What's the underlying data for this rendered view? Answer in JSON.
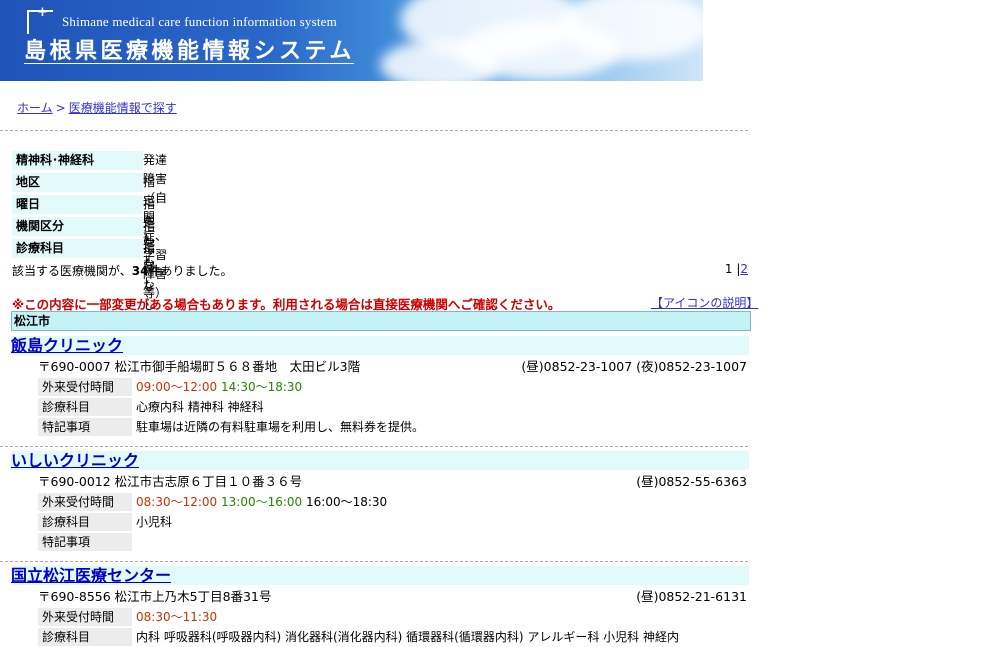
{
  "banner": {
    "subtitle": "Shimane medical care function information system",
    "title": "島根県医療機能情報システム"
  },
  "breadcrumb": {
    "home": "ホーム",
    "separator": ">",
    "current": "医療機能情報で探す"
  },
  "criteria": [
    {
      "label": "精神科･神経科",
      "value": "発達障害（自閉症、学習障害等）"
    },
    {
      "label": "地区",
      "value": "指定なし"
    },
    {
      "label": "曜日",
      "value": "指定なし"
    },
    {
      "label": "機関区分",
      "value": "指定なし"
    },
    {
      "label": "診療科目",
      "value": "指定なし"
    }
  ],
  "result": {
    "prefix": "該当する医療機関が、",
    "count": "34件",
    "suffix": "ありました。"
  },
  "paging": {
    "current": "1",
    "separator": "|",
    "next": "2"
  },
  "notice": "※この内容に一部変更がある場合もあります。利用される場合は直接医療機関へご確認ください。",
  "icon_link": "【アイコンの説明】",
  "region": "松江市",
  "labels": {
    "hours": "外来受付時間",
    "departments": "診療科目",
    "notes": "特記事項"
  },
  "clinics": [
    {
      "name": "飯島クリニック",
      "address": "〒690-0007 松江市御手船場町５６８番地　太田ビル3階",
      "phone": "(昼)0852-23-1007 (夜)0852-23-1007",
      "hours_am": "09:00～12:00",
      "hours_pm": "14:30～18:30",
      "hours_ev": "",
      "departments": "心療内科 精神科 神経科",
      "notes": "駐車場は近隣の有料駐車場を利用し、無料券を提供。"
    },
    {
      "name": "いしいクリニック",
      "address": "〒690-0012 松江市古志原６丁目１０番３６号",
      "phone": "(昼)0852-55-6363",
      "hours_am": "08:30～12:00",
      "hours_pm": "13:00～16:00",
      "hours_ev": "16:00～18:30",
      "departments": "小児科",
      "notes": ""
    },
    {
      "name": "国立松江医療センター",
      "address": "〒690-8556 松江市上乃木5丁目8番31号",
      "phone": "(昼)0852-21-6131",
      "hours_am": "08:30～11:30",
      "hours_pm": "",
      "hours_ev": "",
      "departments": "内科 呼吸器科(呼吸器内科) 消化器科(消化器内科) 循環器科(循環器内科) アレルギー科 小児科 神経内",
      "notes": ""
    }
  ],
  "colors": {
    "banner_blue": "#1f54b8",
    "label_bg": "#e3fafa",
    "region_bg": "#c5f2f5",
    "link": "#0000cc",
    "notice_red": "#cc0000",
    "am_time": "#cc3300",
    "pm_time": "#228800"
  }
}
